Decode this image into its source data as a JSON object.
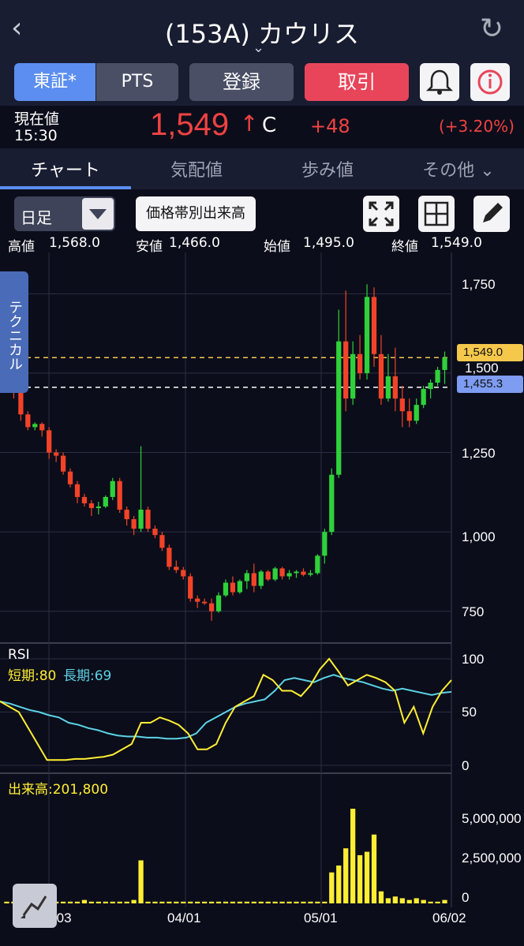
{
  "header": {
    "title": "(153A) カウリス",
    "back_icon": "chevron-left-icon",
    "refresh_icon": "refresh-icon"
  },
  "buttons": {
    "market_tse": "東証*",
    "market_pts": "PTS",
    "register": "登録",
    "trade": "取引",
    "alert_icon": "bell-icon",
    "info_icon": "info-icon"
  },
  "quote": {
    "label": "現在値",
    "time": "15:30",
    "price": "1,549",
    "arrow": "↑",
    "flag": "C",
    "change": "+48",
    "change_pct": "(+3.20%)"
  },
  "tabs": [
    "チャート",
    "気配値",
    "歩み値",
    "その他 ⌄"
  ],
  "controls": {
    "period": "日足",
    "volume_by_price": "価格帯別出来高",
    "fullscreen_icon": "expand-icon",
    "layout_icon": "grid-icon",
    "draw_icon": "pencil-icon"
  },
  "ohlc": {
    "high_label": "高値",
    "high": "1,568.0",
    "low_label": "安値",
    "low": "1,466.0",
    "open_label": "始値",
    "open": "1,495.0",
    "close_label": "終値",
    "close": "1,549.0"
  },
  "side_tab": "テクニカル",
  "price_tags": {
    "last": "1,549.0",
    "line": "1,455.3"
  },
  "rsi": {
    "label": "RSI",
    "short": "短期:80",
    "long": "長期:69"
  },
  "volume": {
    "label": "出来高:201,800"
  },
  "colors": {
    "up": "#2fd13a",
    "down": "#f24328",
    "rsi_short": "#ffee33",
    "rsi_long": "#5cd3e6",
    "vol": "#ffee33"
  },
  "chart_data": {
    "type": "candlestick",
    "x_ticks": [
      "03/03",
      "04/01",
      "05/01",
      "06/02"
    ],
    "price_ticks": [
      "1,750",
      "1,500",
      "1,250",
      "1,000",
      "750"
    ],
    "rsi_ticks": [
      "100",
      "50",
      "0"
    ],
    "volume_ticks": [
      "5,000,000",
      "2,500,000",
      "0"
    ],
    "price_ylim": [
      650,
      1880
    ],
    "candles": [
      [
        1540,
        1570,
        1450,
        1480
      ],
      [
        1480,
        1490,
        1420,
        1440
      ],
      [
        1440,
        1450,
        1350,
        1370
      ],
      [
        1370,
        1380,
        1320,
        1330
      ],
      [
        1330,
        1345,
        1320,
        1340
      ],
      [
        1340,
        1345,
        1300,
        1320
      ],
      [
        1320,
        1330,
        1230,
        1250
      ],
      [
        1250,
        1260,
        1220,
        1240
      ],
      [
        1240,
        1250,
        1180,
        1190
      ],
      [
        1190,
        1200,
        1140,
        1150
      ],
      [
        1150,
        1160,
        1090,
        1110
      ],
      [
        1110,
        1120,
        1080,
        1090
      ],
      [
        1090,
        1100,
        1050,
        1075
      ],
      [
        1075,
        1095,
        1055,
        1080
      ],
      [
        1080,
        1115,
        1075,
        1110
      ],
      [
        1110,
        1170,
        1100,
        1160
      ],
      [
        1160,
        1170,
        1060,
        1070
      ],
      [
        1070,
        1080,
        1020,
        1040
      ],
      [
        1040,
        1050,
        990,
        1010
      ],
      [
        1010,
        1270,
        1000,
        1070
      ],
      [
        1070,
        1080,
        1000,
        1010
      ],
      [
        1010,
        1020,
        980,
        990
      ],
      [
        990,
        1000,
        940,
        950
      ],
      [
        950,
        960,
        880,
        890
      ],
      [
        890,
        910,
        870,
        880
      ],
      [
        880,
        890,
        850,
        860
      ],
      [
        860,
        870,
        780,
        790
      ],
      [
        790,
        800,
        760,
        780
      ],
      [
        780,
        790,
        770,
        775
      ],
      [
        775,
        790,
        720,
        750
      ],
      [
        750,
        810,
        745,
        800
      ],
      [
        800,
        850,
        795,
        840
      ],
      [
        840,
        860,
        800,
        810
      ],
      [
        810,
        850,
        805,
        845
      ],
      [
        845,
        880,
        820,
        870
      ],
      [
        870,
        900,
        810,
        830
      ],
      [
        830,
        880,
        820,
        875
      ],
      [
        875,
        880,
        845,
        850
      ],
      [
        850,
        890,
        845,
        885
      ],
      [
        885,
        890,
        850,
        860
      ],
      [
        860,
        880,
        850,
        870
      ],
      [
        870,
        880,
        855,
        875
      ],
      [
        875,
        885,
        860,
        865
      ],
      [
        865,
        880,
        860,
        870
      ],
      [
        870,
        930,
        865,
        925
      ],
      [
        925,
        1010,
        900,
        1000
      ],
      [
        1000,
        1200,
        990,
        1180
      ],
      [
        1180,
        1700,
        1170,
        1600
      ],
      [
        1600,
        1760,
        1380,
        1420
      ],
      [
        1420,
        1600,
        1400,
        1560
      ],
      [
        1560,
        1620,
        1480,
        1500
      ],
      [
        1500,
        1780,
        1480,
        1740
      ],
      [
        1740,
        1770,
        1520,
        1560
      ],
      [
        1560,
        1620,
        1400,
        1420
      ],
      [
        1420,
        1560,
        1410,
        1490
      ],
      [
        1490,
        1580,
        1380,
        1420
      ],
      [
        1420,
        1460,
        1330,
        1380
      ],
      [
        1380,
        1420,
        1330,
        1350
      ],
      [
        1350,
        1420,
        1340,
        1400
      ],
      [
        1400,
        1460,
        1390,
        1450
      ],
      [
        1450,
        1480,
        1420,
        1470
      ],
      [
        1470,
        1520,
        1460,
        1510
      ],
      [
        1510,
        1568,
        1466,
        1549
      ]
    ],
    "rsi_short": [
      60,
      55,
      50,
      35,
      20,
      5,
      5,
      5,
      6,
      6,
      7,
      8,
      10,
      15,
      20,
      40,
      40,
      45,
      42,
      38,
      30,
      15,
      15,
      20,
      40,
      55,
      60,
      65,
      85,
      80,
      70,
      70,
      65,
      75,
      90,
      100,
      88,
      75,
      80,
      85,
      82,
      78,
      70,
      40,
      55,
      30,
      55,
      70,
      80
    ],
    "rsi_long": [
      60,
      58,
      55,
      52,
      50,
      47,
      45,
      40,
      38,
      35,
      33,
      30,
      28,
      27,
      27,
      26,
      26,
      25,
      25,
      26,
      30,
      40,
      45,
      50,
      55,
      58,
      60,
      62,
      70,
      80,
      82,
      80,
      78,
      82,
      85,
      82,
      80,
      78,
      75,
      72,
      70,
      72,
      70,
      68,
      66,
      68,
      69
    ],
    "volume": [
      0.1,
      0.1,
      0.1,
      0.1,
      0.1,
      0.1,
      0.2,
      0.1,
      0.1,
      0.1,
      0.1,
      0.2,
      0.1,
      0.1,
      0.1,
      0.1,
      0.1,
      0.1,
      0.2,
      2.5,
      0.1,
      0.1,
      0.1,
      0.1,
      0.1,
      0.1,
      0.1,
      0.1,
      0.1,
      0.1,
      0.1,
      0.1,
      0.1,
      0.1,
      0.1,
      0.1,
      0.1,
      0.1,
      0.1,
      0.1,
      0.1,
      0.1,
      0.1,
      0.1,
      0.1,
      0.1,
      1.8,
      2.2,
      3.2,
      5.5,
      2.8,
      3.0,
      4.0,
      0.7,
      0.3,
      0.4,
      0.3,
      0.2,
      0.3,
      0.2,
      0.1,
      0.1,
      0.2
    ]
  }
}
